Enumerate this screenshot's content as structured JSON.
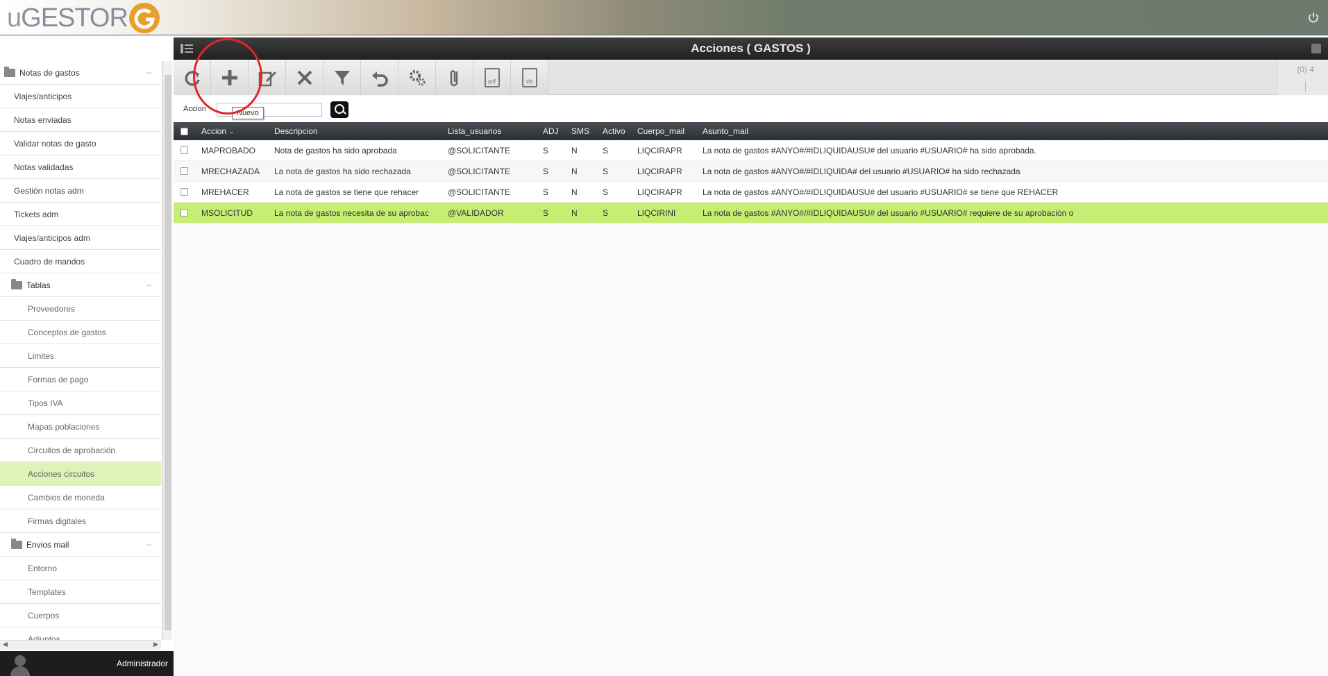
{
  "app": {
    "logo_text_u": "u",
    "logo_text_rest": "GESTOR",
    "brand_color": "#e8a02a"
  },
  "sidebar": {
    "items": [
      {
        "label": "Notas de gastos",
        "type": "group",
        "level": 1
      },
      {
        "label": "Viajes/anticipos",
        "level": 1
      },
      {
        "label": "Notas enviadas",
        "level": 1
      },
      {
        "label": "Validar notas de gasto",
        "level": 1
      },
      {
        "label": "Notas validadas",
        "level": 1
      },
      {
        "label": "Gestión notas adm",
        "level": 1
      },
      {
        "label": "Tickets adm",
        "level": 1
      },
      {
        "label": "Viajes/anticipos adm",
        "level": 1
      },
      {
        "label": "Cuadro de mandos",
        "level": 1
      },
      {
        "label": "Tablas",
        "type": "group",
        "level": 2
      },
      {
        "label": "Proveedores",
        "level": 2
      },
      {
        "label": "Conceptos de gastos",
        "level": 2
      },
      {
        "label": "Limites",
        "level": 2
      },
      {
        "label": "Formas de pago",
        "level": 2
      },
      {
        "label": "Tipos IVA",
        "level": 2
      },
      {
        "label": "Mapas poblaciones",
        "level": 2
      },
      {
        "label": "Circuitos de aprobación",
        "level": 2
      },
      {
        "label": "Acciones circuitos",
        "level": 2,
        "active": true
      },
      {
        "label": "Cambios de moneda",
        "level": 2
      },
      {
        "label": "Firmas digitales",
        "level": 2
      },
      {
        "label": "Envios mail",
        "type": "group",
        "level": 2
      },
      {
        "label": "Entorno",
        "level": 2
      },
      {
        "label": "Templates",
        "level": 2
      },
      {
        "label": "Cuerpos",
        "level": 2
      },
      {
        "label": "Adjuntos",
        "level": 2
      }
    ],
    "collapse_mark": "−"
  },
  "user": {
    "name": "Administrador"
  },
  "main": {
    "title": "Acciones ( GASTOS )",
    "page_count": "(0) 4",
    "toolbar": {
      "pdf_label": "pdf",
      "xls_label": "xls",
      "buttons": [
        "refresh-icon",
        "plus-icon",
        "edit-icon",
        "delete-icon",
        "filter-icon",
        "undo-icon",
        "gears-icon",
        "attach-icon",
        "pdf-icon",
        "xls-icon"
      ]
    },
    "filter": {
      "label": "Accion",
      "value": "",
      "tooltip": "Nuevo"
    },
    "grid": {
      "columns": [
        "Accion",
        "Descripcion",
        "Lista_usuarios",
        "ADJ",
        "SMS",
        "Activo",
        "Cuerpo_mail",
        "Asunto_mail"
      ],
      "rows": [
        [
          "MAPROBADO",
          "Nota de gastos ha sido aprobada",
          "@SOLICITANTE",
          "S",
          "N",
          "S",
          "LIQCIRAPR",
          "La nota de gastos #ANYO#/#IDLIQUIDAUSU# del usuario #USUARIO# ha sido aprobada."
        ],
        [
          "MRECHAZADA",
          "La nota de gastos ha sido rechazada",
          "@SOLICITANTE",
          "S",
          "N",
          "S",
          "LIQCIRAPR",
          "La nota de gastos #ANYO#/#IDLIQUIDA# del usuario #USUARIO# ha sido rechazada"
        ],
        [
          "MREHACER",
          "La nota de gastos se tiene que rehacer",
          "@SOLICITANTE",
          "S",
          "N",
          "S",
          "LIQCIRAPR",
          "La nota de gastos #ANYO#/#IDLIQUIDAUSU# del usuario #USUARIO# se tiene que REHACER"
        ],
        [
          "MSOLICITUD",
          "La nota de gastos necesita de su aprobac",
          "@VALIDADOR",
          "S",
          "N",
          "S",
          "LIQCIRINI",
          "La nota de gastos #ANYO#/#IDLIQUIDAUSU# del usuario #USUARIO# requiere de su aprobación o"
        ]
      ],
      "selected_row": 3,
      "selected_color": "#c6ee72"
    }
  }
}
